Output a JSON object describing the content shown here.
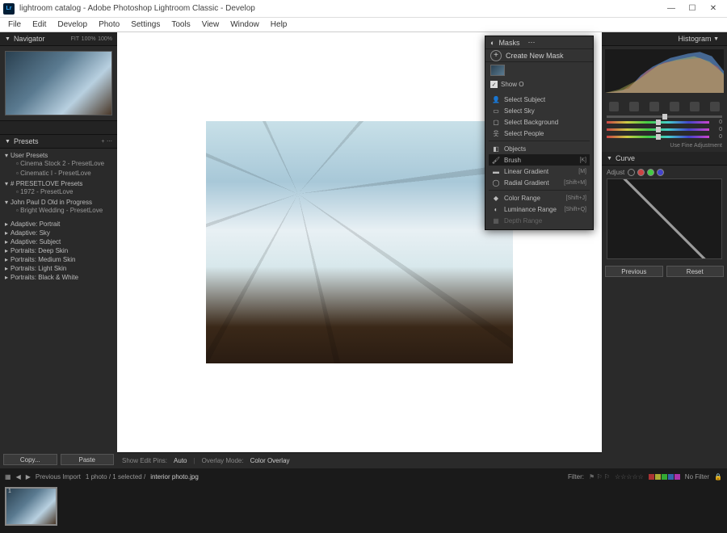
{
  "titlebar": {
    "app_icon": "Lr",
    "title": "lightroom catalog - Adobe Photoshop Lightroom Classic - Develop"
  },
  "menubar": [
    "File",
    "Edit",
    "Develop",
    "Photo",
    "Settings",
    "Tools",
    "View",
    "Window",
    "Help"
  ],
  "navigator": {
    "title": "Navigator",
    "fit": "FIT",
    "zoom1": "100%",
    "zoom2": "100%"
  },
  "presets": {
    "title": "Presets",
    "groups": [
      {
        "name": "User Presets",
        "items": [
          "Cinema Stock 2 - PresetLove",
          "Cinematic I - PresetLove"
        ]
      },
      {
        "name": "# PRESETLOVE Presets",
        "items": [
          "1972 - PresetLove"
        ]
      },
      {
        "name": "John Paul D Old in Progress",
        "items": [
          "Bright Wedding - PresetLove"
        ]
      }
    ],
    "singles": [
      "Adaptive: Portrait",
      "Adaptive: Sky",
      "Adaptive: Subject",
      "Portraits: Deep Skin",
      "Portraits: Medium Skin",
      "Portraits: Light Skin",
      "Portraits: Black & White"
    ],
    "copy": "Copy...",
    "paste": "Paste"
  },
  "toolbar": {
    "show_edit_pins": "Show Edit Pins:",
    "auto": "Auto",
    "overlay_mode": "Overlay Mode:",
    "color_overlay": "Color Overlay"
  },
  "histogram": {
    "title": "Histogram"
  },
  "masks": {
    "title": "Masks",
    "create": "Create New Mask",
    "show_overlay": "Show O",
    "subject_group": [
      {
        "label": "Select Subject"
      },
      {
        "label": "Select Sky"
      },
      {
        "label": "Select Background"
      },
      {
        "label": "Select People"
      }
    ],
    "objects_label": "Objects",
    "tool_group": [
      {
        "label": "Brush",
        "shortcut": "[K]",
        "selected": true
      },
      {
        "label": "Linear Gradient",
        "shortcut": "[M]"
      },
      {
        "label": "Radial Gradient",
        "shortcut": "[Shift+M]"
      }
    ],
    "range_group": [
      {
        "label": "Color Range",
        "shortcut": "[Shift+J]"
      },
      {
        "label": "Luminance Range",
        "shortcut": "[Shift+Q]"
      },
      {
        "label": "Depth Range",
        "dim": true
      }
    ]
  },
  "adjust": {
    "fine": "Use Fine Adjustment",
    "values": [
      "0",
      "0",
      "0"
    ]
  },
  "curve": {
    "title": "Curve",
    "adjust": "Adjust",
    "previous": "Previous",
    "reset": "Reset"
  },
  "filmstrip": {
    "prev_import": "Previous Import",
    "count": "1 photo / 1 selected /",
    "filename": "interior photo.jpg",
    "filter": "Filter:",
    "no_filter": "No Filter"
  }
}
